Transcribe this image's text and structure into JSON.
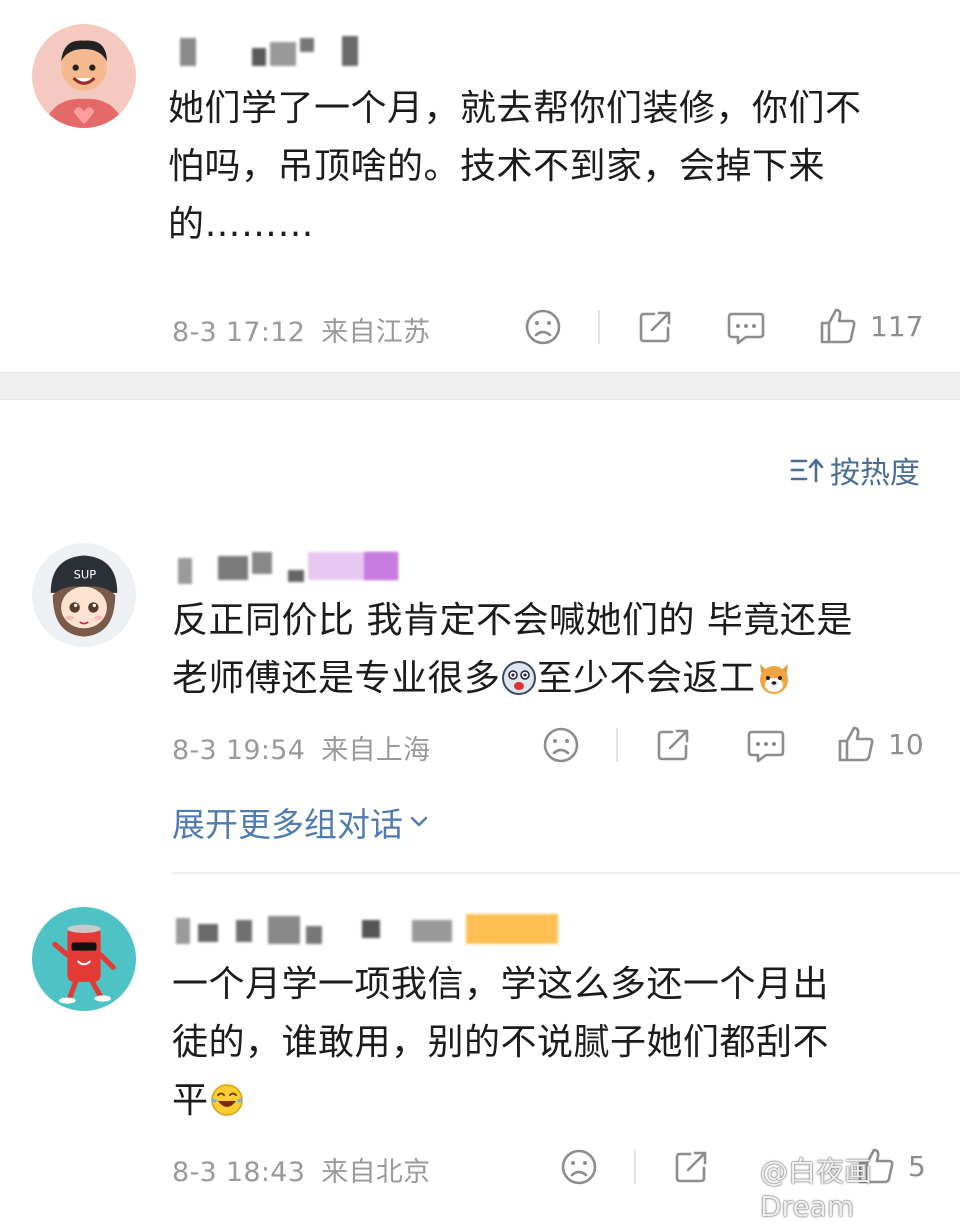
{
  "comments": [
    {
      "text_lines": [
        "她们学了一个月，就去帮你们装修，你们不",
        "怕吗，吊顶啥的。技术不到家，会掉下来",
        "的………"
      ],
      "time": "8-3 17:12",
      "location": "来自江苏",
      "likes": "117"
    },
    {
      "text_lines": [
        "反正同价比 我肯定不会喊她们的 毕竟还是",
        "老师傅还是专业很多",
        "至少不会返工"
      ],
      "time": "8-3 19:54",
      "location": "来自上海",
      "likes": "10"
    },
    {
      "text_lines": [
        "一个月学一项我信，学这么多还一个月出",
        "徒的，谁敢用，别的不说腻子她们都刮不",
        "平"
      ],
      "time": "8-3 18:43",
      "location": "来自北京",
      "likes": "5"
    }
  ],
  "sort_label": "按热度",
  "expand_label": "展开更多组对话",
  "watermark": "@白夜画Dream",
  "colors": {
    "link": "#4f7bb3",
    "meta": "#9a9a9a",
    "band": "#efefef"
  },
  "icons": [
    "sad-face-icon",
    "share-icon",
    "comment-icon",
    "thumbs-up-icon",
    "sort-icon",
    "chevron-down-icon"
  ]
}
